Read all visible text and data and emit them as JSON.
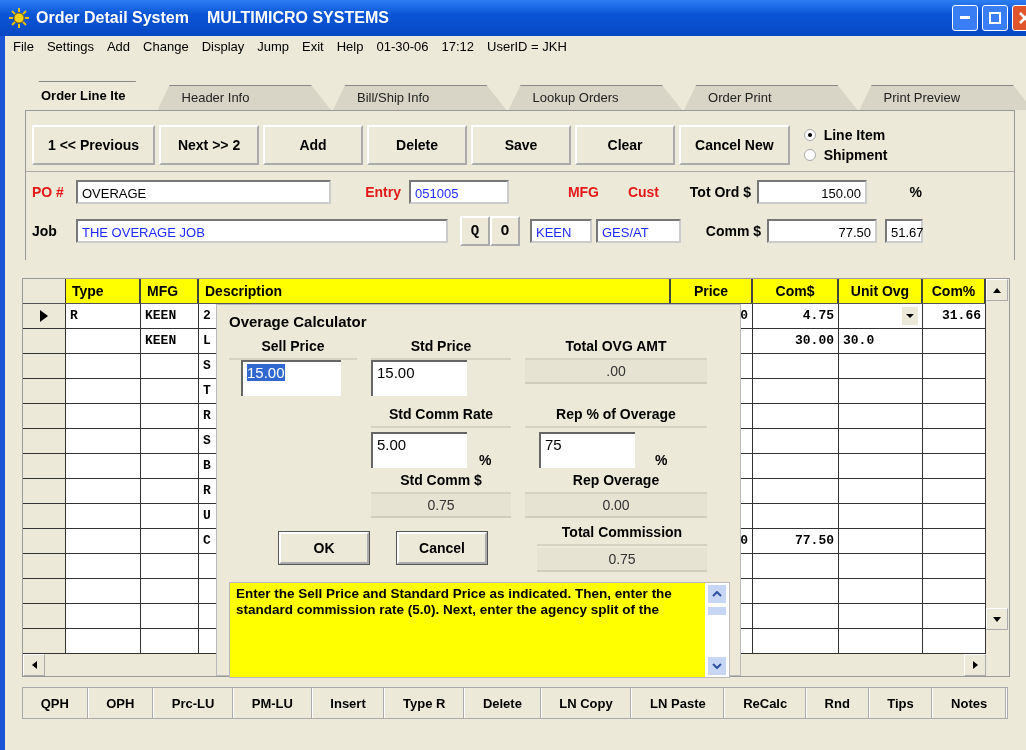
{
  "window": {
    "title": "Order Detail System",
    "company": "MULTIMICRO SYSTEMS"
  },
  "menu": [
    "File",
    "Settings",
    "Add",
    "Change",
    "Display",
    "Jump",
    "Exit",
    "Help"
  ],
  "session": {
    "date": "01-30-06",
    "time": "17:12",
    "user": "UserID = JKH"
  },
  "tabs": [
    {
      "label": "Order Line Ite",
      "selected": true
    },
    {
      "label": "Header Info",
      "selected": false
    },
    {
      "label": "Bill/Ship Info",
      "selected": false
    },
    {
      "label": "Lookup Orders",
      "selected": false
    },
    {
      "label": "Order Print",
      "selected": false
    },
    {
      "label": "Print Preview",
      "selected": false
    }
  ],
  "toolbar": [
    "1 << Previous",
    "Next >>  2",
    "Add",
    "Delete",
    "Save",
    "Clear",
    "Cancel New"
  ],
  "mode_options": [
    {
      "label": "Line Item",
      "selected": true
    },
    {
      "label": "Shipment",
      "selected": false
    }
  ],
  "header": {
    "po_label": "PO #",
    "po": "OVERAGE",
    "entry_label": "Entry",
    "entry": "051005",
    "mfg_label": "MFG",
    "cust_label": "Cust",
    "tot_ord_label": "Tot Ord $",
    "tot_ord": "150.00",
    "pct_label": "%",
    "job_label": "Job",
    "job": "THE OVERAGE JOB",
    "q_button": "Q",
    "o_button": "O",
    "mfg": "KEEN",
    "cust": "GES/AT",
    "comm_label": "Comm $",
    "comm": "77.50",
    "pct": "51.67"
  },
  "grid": {
    "columns": [
      "Type",
      "MFG",
      "Description",
      "Price",
      "Com$",
      "Unit Ovg",
      "Com%"
    ],
    "rows": [
      {
        "selected": true,
        "dropdown": true,
        "cells": [
          "R",
          "KEEN",
          "2",
          "0",
          "4.75",
          "",
          "31.66"
        ]
      },
      {
        "selected": false,
        "dropdown": false,
        "cells": [
          "",
          "KEEN",
          "L",
          "",
          "30.00",
          "30.0",
          ""
        ]
      },
      {
        "selected": false,
        "dropdown": false,
        "cells": [
          "",
          "",
          "S",
          "",
          "",
          "",
          ""
        ]
      },
      {
        "selected": false,
        "dropdown": false,
        "cells": [
          "",
          "",
          "T",
          "",
          "",
          "",
          ""
        ]
      },
      {
        "selected": false,
        "dropdown": false,
        "cells": [
          "",
          "",
          "R",
          "",
          "",
          "",
          ""
        ]
      },
      {
        "selected": false,
        "dropdown": false,
        "cells": [
          "",
          "",
          "S",
          "",
          "",
          "",
          ""
        ]
      },
      {
        "selected": false,
        "dropdown": false,
        "cells": [
          "",
          "",
          "B",
          "",
          "",
          "",
          ""
        ]
      },
      {
        "selected": false,
        "dropdown": false,
        "cells": [
          "",
          "",
          "R",
          "",
          "",
          "",
          ""
        ]
      },
      {
        "selected": false,
        "dropdown": false,
        "cells": [
          "",
          "",
          "U",
          "",
          "",
          "",
          ""
        ]
      },
      {
        "selected": false,
        "dropdown": false,
        "cells": [
          "",
          "",
          "C",
          "0",
          "77.50",
          "",
          ""
        ]
      },
      {
        "selected": false,
        "dropdown": false,
        "cells": [
          "",
          "",
          "",
          "",
          "",
          "",
          ""
        ]
      },
      {
        "selected": false,
        "dropdown": false,
        "cells": [
          "",
          "",
          "",
          "",
          "",
          "",
          ""
        ]
      },
      {
        "selected": false,
        "dropdown": false,
        "cells": [
          "",
          "",
          "",
          "",
          "",
          "",
          ""
        ]
      },
      {
        "selected": false,
        "dropdown": false,
        "cells": [
          "",
          "",
          "",
          "",
          "",
          "",
          ""
        ]
      }
    ]
  },
  "dialog": {
    "title": "Overage Calculator",
    "sell_price_label": "Sell Price",
    "sell_price": "15.00",
    "std_price_label": "Std Price",
    "std_price": "15.00",
    "std_rate_label": "Std Comm Rate",
    "std_rate": "5.00",
    "std_rate_unit": "%",
    "std_comm_label": "Std Comm $",
    "std_comm": "0.75",
    "total_ovg_label": "Total OVG AMT",
    "total_ovg": ".00",
    "rep_pct_label": "Rep % of Overage",
    "rep_pct": "75",
    "rep_pct_unit": "%",
    "rep_ovg_label": "Rep Overage",
    "rep_ovg": "0.00",
    "total_comm_label": "Total Commission",
    "total_comm": "0.75",
    "ok": "OK",
    "cancel": "Cancel",
    "help": "Enter the Sell Price and Standard Price as indicated.  Then, enter the standard commission rate (5.0).  Next, enter the agency split of the"
  },
  "bottom_buttons": [
    "QPH",
    "OPH",
    "Prc-LU",
    "PM-LU",
    "Insert",
    "Type R",
    "Delete",
    "LN Copy",
    "LN Paste",
    "ReCalc",
    "Rnd",
    "Tips",
    "Notes"
  ]
}
